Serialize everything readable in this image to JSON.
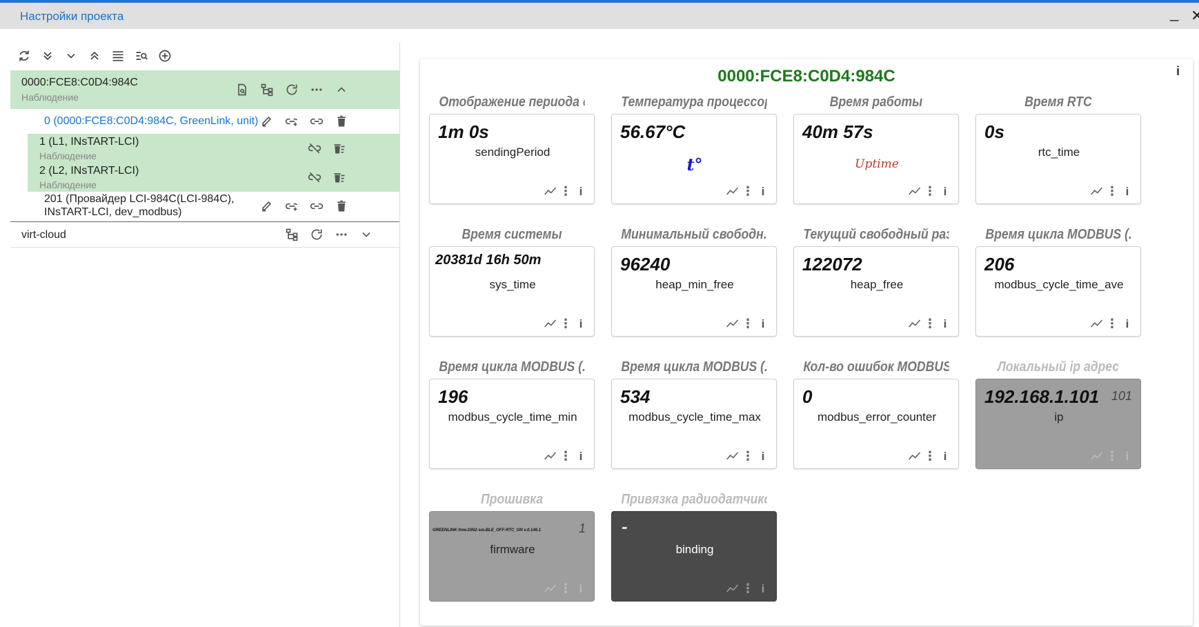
{
  "window": {
    "title": "Настройки проекта",
    "minimize": "_",
    "close": "✕"
  },
  "tree": {
    "root": {
      "label": "0000:FCE8:C0D4:984C",
      "status": "Наблюдение"
    },
    "unit": {
      "label": "0 (0000:FCE8:C0D4:984C, GreenLink, unit)"
    },
    "l1": {
      "label": "1 (L1, INsTART-LCI)",
      "status": "Наблюдение"
    },
    "l2": {
      "label": "2 (L2, INsTART-LCI)",
      "status": "Наблюдение"
    },
    "provider": {
      "line1": "201 (Провайдер LCI-984C(LCI-984C),",
      "line2": "INsTART-LCI, dev_modbus)"
    },
    "cloud": {
      "label": "virt-cloud"
    }
  },
  "panel": {
    "title": "0000:FCE8:C0D4:984C",
    "info": "i",
    "tiles": [
      {
        "title": "Отображение периода о...",
        "value": "1m 0s",
        "key": "sendingPeriod"
      },
      {
        "title": "Температура процессора",
        "value": "56.67°C",
        "key": "",
        "pic": "t°"
      },
      {
        "title": "Время работы",
        "value": "40m 57s",
        "key": "",
        "pic": "Uptime"
      },
      {
        "title": "Время RTC",
        "value": "0s",
        "key": "rtc_time"
      },
      {
        "title": "Время системы",
        "value": "20381d 16h 50m",
        "key": "sys_time"
      },
      {
        "title": "Минимальный свободн...",
        "value": "96240",
        "key": "heap_min_free"
      },
      {
        "title": "Текущий свободный раз...",
        "value": "122072",
        "key": "heap_free"
      },
      {
        "title": "Время цикла MODBUS (...",
        "value": "206",
        "key": "modbus_cycle_time_ave"
      },
      {
        "title": "Время цикла MODBUS (...",
        "value": "196",
        "key": "modbus_cycle_time_min"
      },
      {
        "title": "Время цикла MODBUS (...",
        "value": "534",
        "key": "modbus_cycle_time_max"
      },
      {
        "title": "Кол-во ошибок MODBUS",
        "value": "0",
        "key": "modbus_error_counter"
      },
      {
        "title": "Локальный ip адрес",
        "value": "192.168.1.101",
        "key": "ip",
        "corner": "101"
      },
      {
        "title": "Прошивка",
        "value": "GREENLINK-fmw.DIN2-sm.BLE_OFF-RTC_ON v.0.146.1",
        "key": "firmware",
        "corner": "1"
      },
      {
        "title": "Привязка радиодатчиков",
        "value": "-",
        "key": "binding"
      }
    ],
    "action_dots": "⋮",
    "action_info": "i"
  }
}
